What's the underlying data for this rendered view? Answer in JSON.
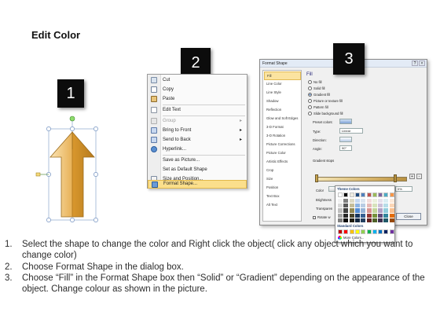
{
  "title": "Edit Color",
  "badges": [
    "1",
    "2",
    "3"
  ],
  "context_menu": {
    "items": [
      {
        "label": "Cut",
        "icon": "scissors-icon",
        "submenu": false,
        "disabled": false
      },
      {
        "label": "Copy",
        "icon": "copy-icon",
        "submenu": false,
        "disabled": false
      },
      {
        "label": "Paste",
        "icon": "paste-icon",
        "submenu": false,
        "disabled": false
      },
      {
        "label": "Edit Text",
        "icon": "edit-text-icon",
        "submenu": false,
        "disabled": false
      },
      {
        "label": "Group",
        "icon": "group-icon",
        "submenu": true,
        "disabled": true
      },
      {
        "label": "Bring to Front",
        "icon": "bring-front-icon",
        "submenu": true,
        "disabled": false
      },
      {
        "label": "Send to Back",
        "icon": "send-back-icon",
        "submenu": true,
        "disabled": false
      },
      {
        "label": "Hyperlink...",
        "icon": "hyperlink-icon",
        "submenu": false,
        "disabled": false
      },
      {
        "label": "Save as Picture...",
        "icon": "",
        "submenu": false,
        "disabled": false
      },
      {
        "label": "Set as Default Shape",
        "icon": "",
        "submenu": false,
        "disabled": false
      },
      {
        "label": "Size and Position...",
        "icon": "size-position-icon",
        "submenu": false,
        "disabled": false
      },
      {
        "label": "Format Shape...",
        "icon": "format-shape-icon",
        "submenu": false,
        "disabled": false
      }
    ]
  },
  "dialog": {
    "title": "Format Shape",
    "categories": [
      "Fill",
      "Line Color",
      "Line Style",
      "Shadow",
      "Reflection",
      "Glow and Soft Edges",
      "3-D Format",
      "3-D Rotation",
      "Picture Corrections",
      "Picture Color",
      "Artistic Effects",
      "Crop",
      "Size",
      "Position",
      "Text Box",
      "Alt Text"
    ],
    "pane_heading": "Fill",
    "fill_options": [
      "No fill",
      "Solid fill",
      "Gradient fill",
      "Picture or texture fill",
      "Pattern fill",
      "Slide background fill"
    ],
    "selected_fill": "Gradient fill",
    "preset_colors_label": "Preset colors:",
    "type_label": "Type:",
    "type_value": "Linear",
    "direction_label": "Direction:",
    "angle_label": "Angle:",
    "angle_value": "90°",
    "gradient_stops_label": "Gradient stops",
    "color_label": "Color",
    "position_label": "Position:",
    "position_value": "0%",
    "brightness_label": "Brightness",
    "transparency_label": "Transparen",
    "rotate_label": "Rotate w",
    "close_label": "Close"
  },
  "color_picker": {
    "theme_colors_label": "Theme Colors",
    "standard_colors_label": "Standard Colors",
    "more_colors_label": "More Colors..."
  },
  "colors": {
    "arrow_light": "#f6d79a",
    "arrow_dark": "#d99a2e",
    "badge_bg": "#0c0c0c",
    "menu_highlight": "#fbdf8c"
  },
  "steps": [
    {
      "num": "1.",
      "text": "Select the shape to change the color and Right click the object( click any object which you want to change color)"
    },
    {
      "num": "2.",
      "text": "Choose Format Shape in the dialog box."
    },
    {
      "num": "3.",
      "text": "Choose “Fill” in the Format Shape box then “Solid” or “Gradient” depending on the appearance of the object. Change colour as shown in the picture."
    }
  ]
}
